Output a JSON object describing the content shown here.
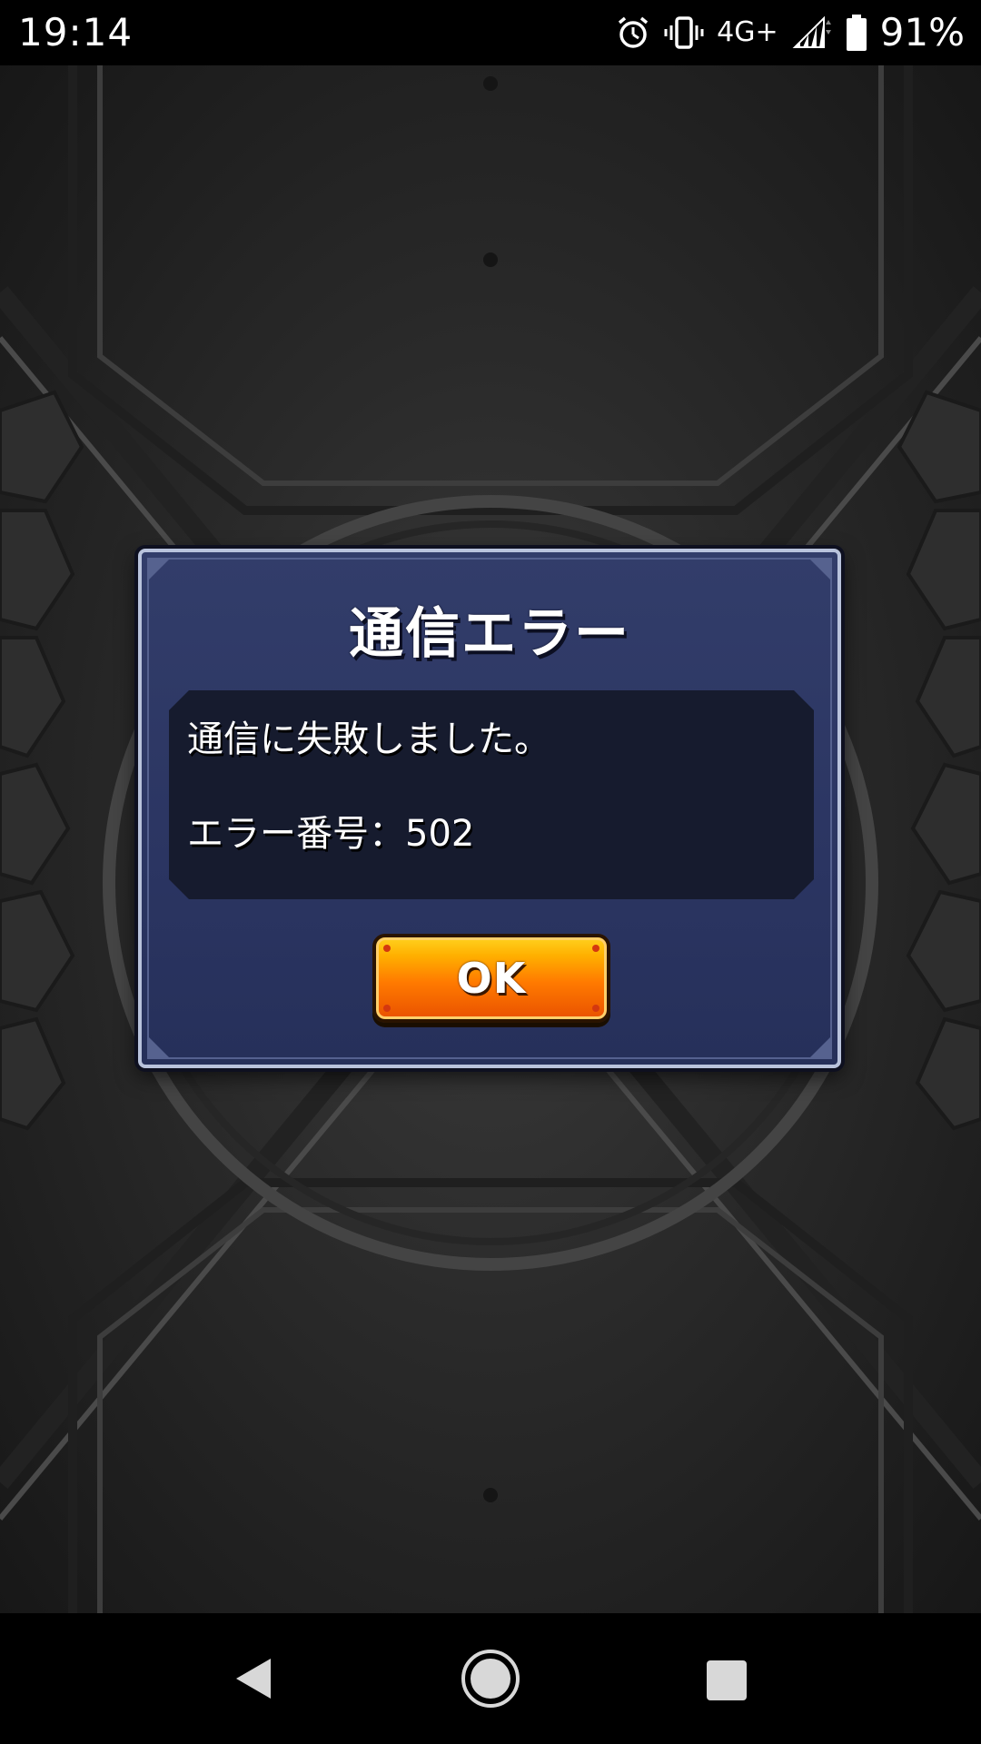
{
  "status_bar": {
    "time": "19:14",
    "network": "4G+",
    "battery": "91%",
    "icons": [
      "alarm-icon",
      "vibrate-icon",
      "signal-icon",
      "battery-icon"
    ]
  },
  "dialog": {
    "title": "通信エラー",
    "message": "通信に失敗しました。",
    "error_code": "エラー番号：502",
    "ok_label": "OK"
  },
  "nav_bar": {
    "icons": [
      "back-icon",
      "home-icon",
      "recents-icon"
    ]
  },
  "colors": {
    "dialog_bg": "#2b3562",
    "dialog_border": "#b9c3dc",
    "message_bg": "#161b2e",
    "button_orange": "#ff7a00",
    "button_yellow": "#ffd21f"
  }
}
